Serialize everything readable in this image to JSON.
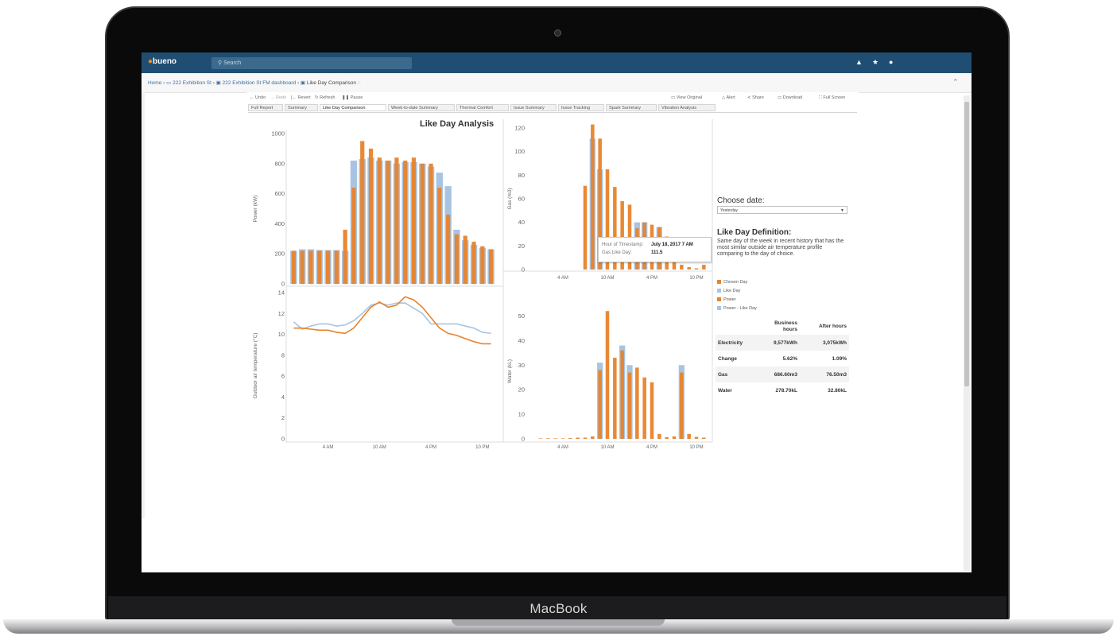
{
  "device": {
    "brand": "MacBook"
  },
  "app": {
    "logo": "bueno",
    "search_placeholder": "Search"
  },
  "breadcrumb": {
    "home": "Home",
    "item1": "222 Exhibition St",
    "item2": "222 Exhibition St FM dashboard",
    "item3": "Like Day Comparison"
  },
  "toolbar": {
    "undo": "Undo",
    "redo": "Redo",
    "revert": "Revert",
    "refresh": "Refresh",
    "pause": "Pause",
    "view_original": "View Original",
    "alert": "Alert",
    "share": "Share",
    "download": "Download",
    "full_screen": "Full Screen"
  },
  "tabs": [
    "Full Report",
    "Summary",
    "Like Day Comparison",
    "Week-to-date Summary",
    "Thermal Comfort",
    "Issue Summary",
    "Issue Tracking",
    "Spark Summary",
    "Vibration Analysis"
  ],
  "active_tab": "Like Day Comparison",
  "viz_title": "Like Day Analysis",
  "chart_data": [
    {
      "type": "bar",
      "name": "power",
      "ylabel": "Power (kW)",
      "ylim": [
        0,
        1000
      ],
      "yticks": [
        "0",
        "200",
        "400",
        "600",
        "800",
        "1000"
      ],
      "x": [
        0,
        1,
        2,
        3,
        4,
        5,
        6,
        7,
        8,
        9,
        10,
        11,
        12,
        13,
        14,
        15,
        16,
        17,
        18,
        19,
        20,
        21,
        22,
        23
      ],
      "series": [
        {
          "name": "Power",
          "values": [
            220,
            220,
            220,
            220,
            220,
            220,
            360,
            640,
            950,
            900,
            840,
            820,
            840,
            820,
            840,
            800,
            800,
            640,
            460,
            330,
            320,
            280,
            250,
            230
          ]
        },
        {
          "name": "Power - Like Day",
          "values": [
            220,
            230,
            230,
            225,
            225,
            225,
            220,
            820,
            830,
            840,
            820,
            820,
            800,
            810,
            810,
            800,
            780,
            740,
            650,
            360,
            290,
            260,
            240,
            230
          ]
        }
      ]
    },
    {
      "type": "line",
      "name": "temperature",
      "ylabel": "Outdoor air temperature (°C)",
      "ylim": [
        0,
        14
      ],
      "yticks": [
        "0",
        "2",
        "4",
        "6",
        "8",
        "10",
        "12",
        "14"
      ],
      "xticks": [
        "4 AM",
        "10 AM",
        "4 PM",
        "10 PM"
      ],
      "x": [
        0,
        1,
        2,
        3,
        4,
        5,
        6,
        7,
        8,
        9,
        10,
        11,
        12,
        13,
        14,
        15,
        16,
        17,
        18,
        19,
        20,
        21,
        22,
        23
      ],
      "series": [
        {
          "name": "Chosen Day",
          "values": [
            10.6,
            10.6,
            10.5,
            10.4,
            10.4,
            10.2,
            10.1,
            10.6,
            11.6,
            12.6,
            13.1,
            12.6,
            12.8,
            13.6,
            13.3,
            12.6,
            11.6,
            10.6,
            10.1,
            9.9,
            9.6,
            9.3,
            9.1,
            9.1
          ]
        },
        {
          "name": "Like Day",
          "values": [
            11.2,
            10.5,
            10.8,
            11.0,
            11.0,
            10.8,
            10.9,
            11.3,
            12.0,
            12.8,
            13.0,
            12.8,
            13.0,
            13.0,
            12.5,
            12.0,
            11.0,
            11.0,
            11.0,
            11.0,
            10.8,
            10.6,
            10.2,
            10.1
          ]
        }
      ]
    },
    {
      "type": "bar",
      "name": "gas",
      "ylabel": "Gas (m3)",
      "ylim": [
        0,
        120
      ],
      "yticks": [
        "0",
        "20",
        "40",
        "60",
        "80",
        "100",
        "120"
      ],
      "xticks": [
        "4 AM",
        "10 AM",
        "4 PM",
        "10 PM"
      ],
      "x": [
        0,
        1,
        2,
        3,
        4,
        5,
        6,
        7,
        8,
        9,
        10,
        11,
        12,
        13,
        14,
        15,
        16,
        17,
        18,
        19,
        20,
        21,
        22,
        23
      ],
      "series": [
        {
          "name": "Chosen Day",
          "values": [
            0,
            0,
            0,
            0,
            0,
            0,
            0,
            71,
            123,
            111,
            85,
            70,
            58,
            55,
            35,
            40,
            38,
            36,
            28,
            8,
            4,
            2,
            1,
            4
          ]
        },
        {
          "name": "Like Day",
          "values": [
            0,
            0,
            0,
            0,
            0,
            0,
            0,
            0,
            111,
            85,
            0,
            0,
            0,
            0,
            40,
            40,
            0,
            36,
            0,
            0,
            0,
            0,
            0,
            0
          ]
        }
      ]
    },
    {
      "type": "bar",
      "name": "water",
      "ylabel": "Water (kL)",
      "ylim": [
        0,
        55
      ],
      "yticks": [
        "0",
        "10",
        "20",
        "30",
        "40",
        "50"
      ],
      "xticks": [
        "4 AM",
        "10 AM",
        "4 PM",
        "10 PM"
      ],
      "x": [
        0,
        1,
        2,
        3,
        4,
        5,
        6,
        7,
        8,
        9,
        10,
        11,
        12,
        13,
        14,
        15,
        16,
        17,
        18,
        19,
        20,
        21,
        22,
        23
      ],
      "series": [
        {
          "name": "Chosen Day",
          "values": [
            0,
            0.2,
            0.2,
            0.2,
            0.2,
            0.3,
            0.5,
            0.5,
            1.0,
            28,
            52,
            33,
            36,
            27,
            29,
            25,
            23,
            2,
            0.7,
            1.0,
            27,
            2,
            0.8,
            0.5
          ]
        },
        {
          "name": "Like Day",
          "values": [
            0,
            0,
            0,
            0,
            0,
            0,
            0,
            0,
            0,
            31,
            0,
            0,
            38,
            30,
            0,
            0,
            0,
            0,
            0,
            0,
            30,
            0,
            0,
            0
          ]
        }
      ]
    }
  ],
  "tooltip": {
    "label1": "Hour of Timestamp:",
    "value1": "July 18, 2017 7 AM",
    "label2": "Gas Like Day:",
    "value2": "111.5"
  },
  "panel": {
    "choose_label": "Choose date:",
    "choose_value": "Yesterday",
    "def_title": "Like Day Definition:",
    "def_text": "Same day of the week in recent history that has the most similar outside air temperature profile comparing to the day of choice.",
    "legend": [
      {
        "label": "Chosen Day",
        "color": "#e8832a"
      },
      {
        "label": "Like Day",
        "color": "#a9c4e2"
      },
      {
        "label": "Power",
        "color": "#e8832a"
      },
      {
        "label": "Power - Like Day",
        "color": "#a9c4e2"
      }
    ],
    "table": {
      "headers": [
        "Business hours",
        "After hours"
      ],
      "rows": [
        {
          "label": "Electricity",
          "business": "9,577kWh",
          "after": "3,075kWh"
        },
        {
          "label": "Change",
          "business": "5.62%",
          "after": "1.09%"
        },
        {
          "label": "Gas",
          "business": "686.60m3",
          "after": "76.50m3"
        },
        {
          "label": "Water",
          "business": "278.70kL",
          "after": "32.80kL"
        }
      ]
    }
  },
  "colors": {
    "chosen": "#e8832a",
    "like": "#a9c4e2",
    "topbar": "#1f4e72"
  }
}
